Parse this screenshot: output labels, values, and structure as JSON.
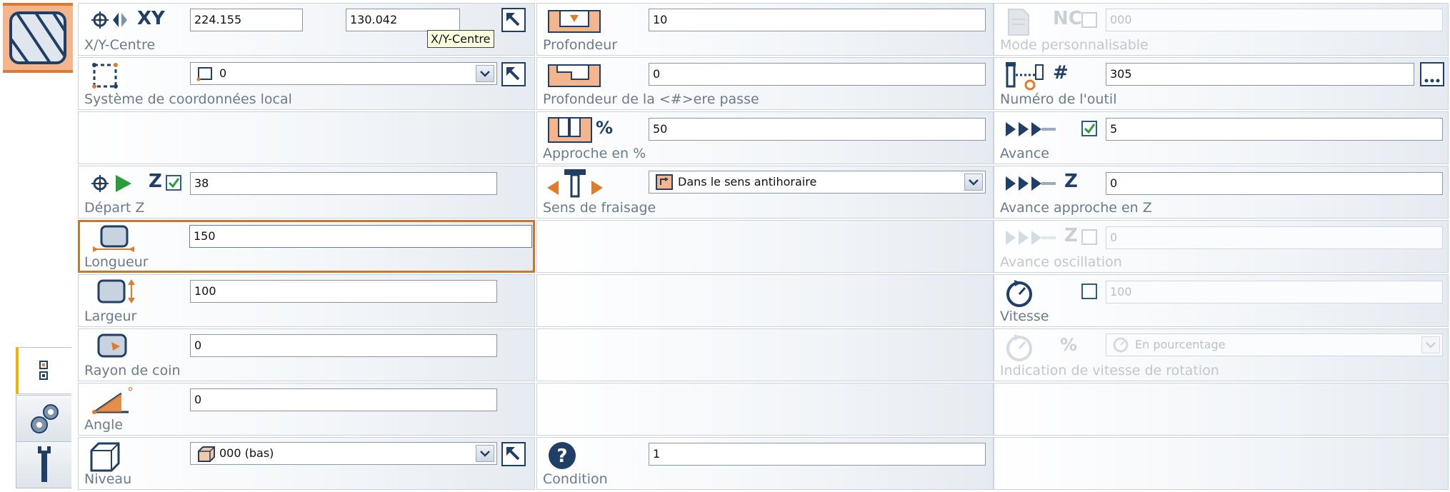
{
  "colors": {
    "accent": "#c8772f",
    "icon_blue": "#1f3f66",
    "icon_orange": "#e07b2c",
    "check_green": "#2a9d3a",
    "label": "#6a7a8e"
  },
  "col1": {
    "xy_centre": {
      "icon_text": "XY",
      "x": "224.155",
      "y": "130.042",
      "label": "X/Y-Centre",
      "tooltip": "X/Y-Centre"
    },
    "local_coords": {
      "value": "0",
      "label": "Système de coordonnées local"
    },
    "depart_z": {
      "icon_text": "Z",
      "value": "38",
      "label": "Départ Z",
      "checked": true
    },
    "longueur": {
      "value": "150",
      "label": "Longueur"
    },
    "largeur": {
      "value": "100",
      "label": "Largeur"
    },
    "rayon": {
      "value": "0",
      "label": "Rayon de coin"
    },
    "angle": {
      "value": "0",
      "label": "Angle",
      "icon_text": "°"
    },
    "niveau": {
      "value": "000 (bas)",
      "label": "Niveau"
    }
  },
  "col2": {
    "profondeur": {
      "value": "10",
      "label": "Profondeur"
    },
    "profondeur_passe": {
      "value": "0",
      "label": "Profondeur de la <#>ere passe"
    },
    "approche": {
      "icon_text": "%",
      "value": "50",
      "label": "Approche en %"
    },
    "sens": {
      "value": "Dans le sens antihoraire",
      "label": "Sens de fraisage"
    },
    "condition": {
      "value": "1",
      "label": "Condition"
    }
  },
  "col3": {
    "mode": {
      "icon_text": "NC",
      "value": "000",
      "label": "Mode personnalisable"
    },
    "outil": {
      "icon_text": "#",
      "value": "305",
      "label": "Numéro de l'outil"
    },
    "avance": {
      "value": "5",
      "label": "Avance",
      "checked": true
    },
    "avance_z": {
      "icon_text": "Z",
      "value": "0",
      "label": "Avance approche en Z"
    },
    "avance_osc": {
      "icon_text": "Z",
      "value": "0",
      "label": "Avance oscillation"
    },
    "vitesse": {
      "value": "100",
      "label": "Vitesse"
    },
    "indication": {
      "icon_text": "%",
      "value": "En pourcentage",
      "label": "Indication de vitesse de rotation"
    }
  }
}
